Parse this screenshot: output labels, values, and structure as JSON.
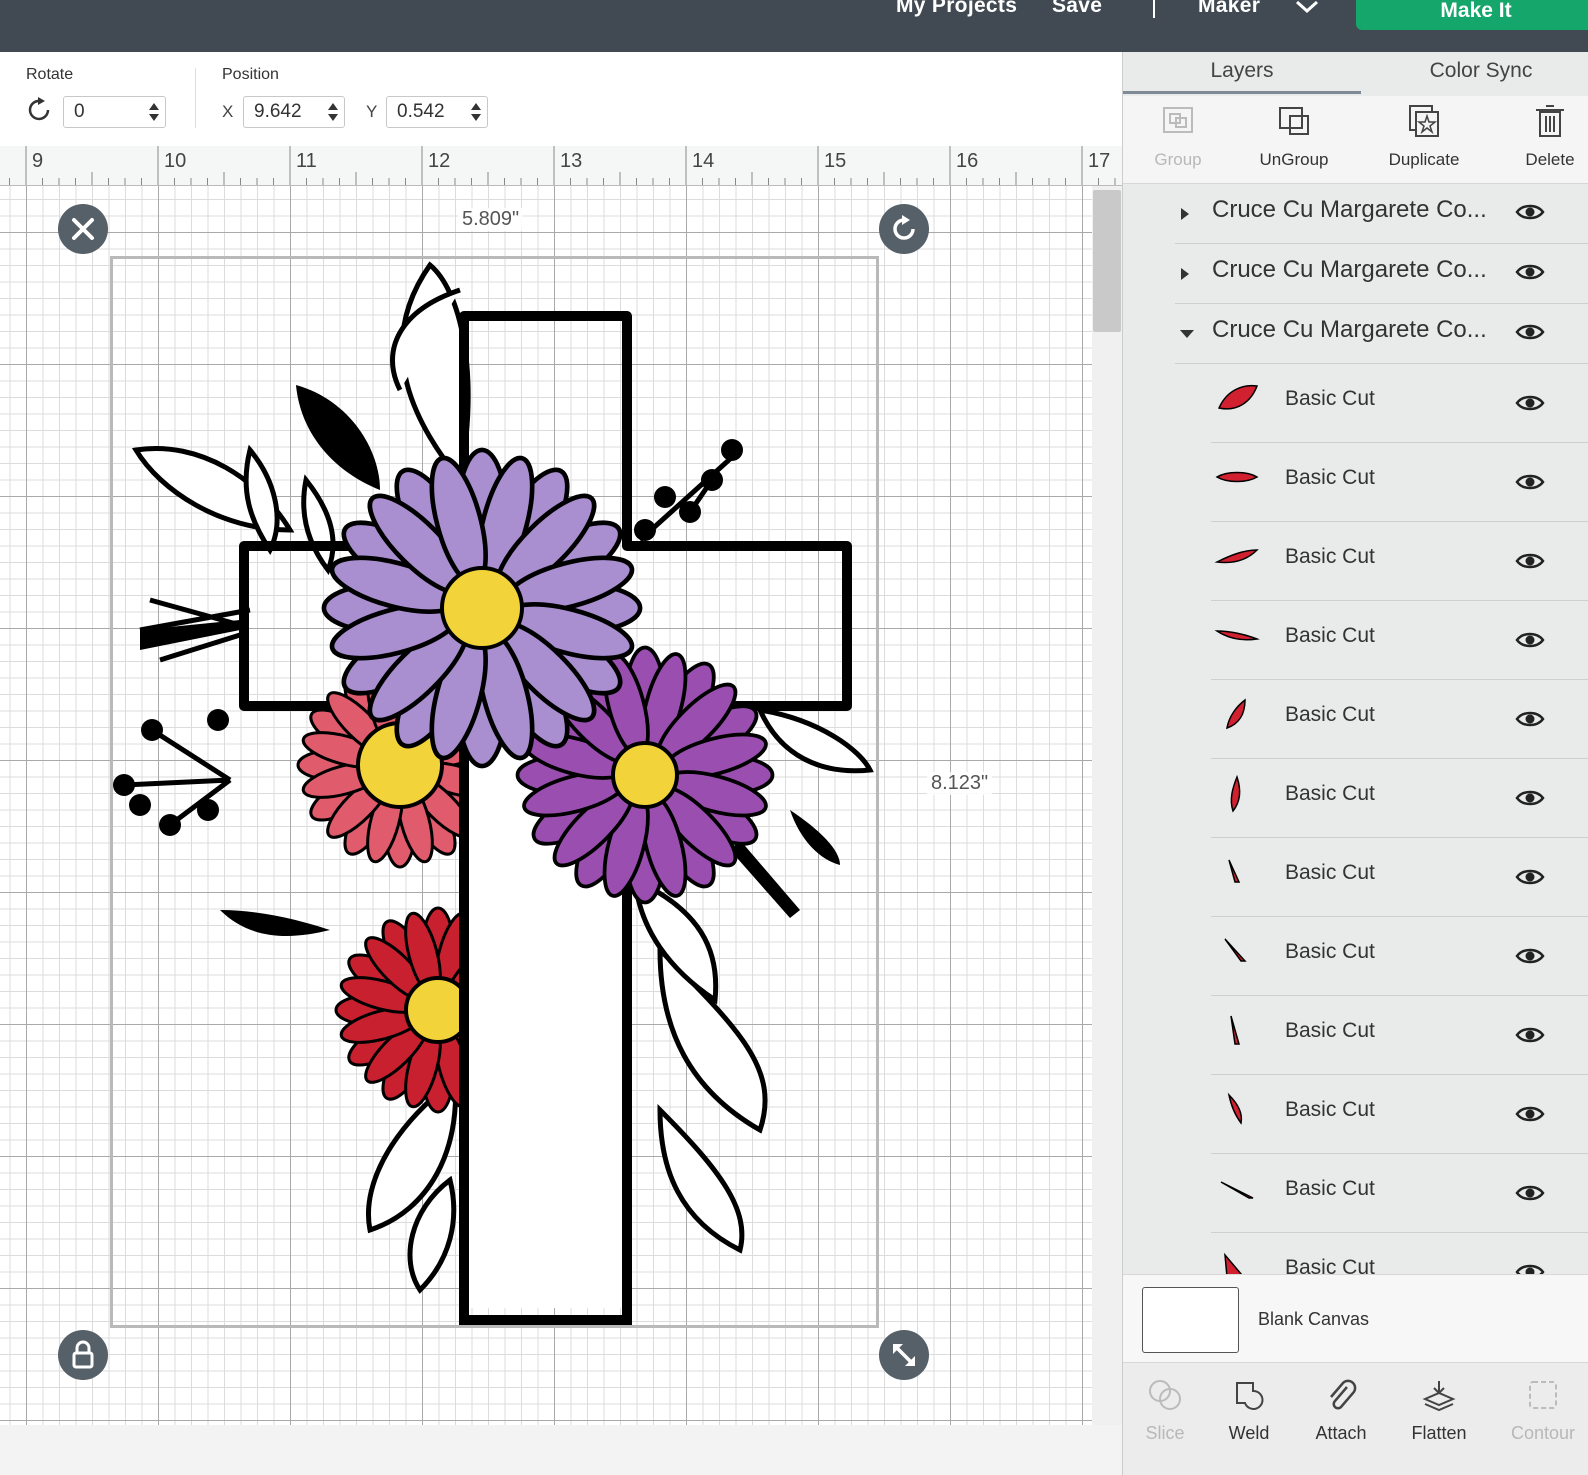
{
  "header": {
    "my_projects_label": "My Projects",
    "save_label": "Save",
    "machine_label": "Maker",
    "make_it_label": "Make It"
  },
  "toolbar": {
    "rotate_label": "Rotate",
    "rotate_value": "0",
    "position_label": "Position",
    "x_label": "X",
    "x_value": "9.642",
    "y_label": "Y",
    "y_value": "0.542"
  },
  "ruler": {
    "ticks": [
      "9",
      "10",
      "11",
      "12",
      "13",
      "14",
      "15",
      "16",
      "17"
    ]
  },
  "canvas": {
    "width_readout": "5.809\"",
    "height_readout": "8.123\""
  },
  "panel": {
    "tabs": [
      {
        "label": "Layers",
        "active": true
      },
      {
        "label": "Color Sync",
        "active": false
      }
    ],
    "tools": [
      {
        "label": "Group",
        "enabled": false
      },
      {
        "label": "UnGroup",
        "enabled": true
      },
      {
        "label": "Duplicate",
        "enabled": true
      },
      {
        "label": "Delete",
        "enabled": true
      }
    ],
    "groups": [
      {
        "name": "Cruce Cu Margarete Co...",
        "expanded": false
      },
      {
        "name": "Cruce Cu Margarete Co...",
        "expanded": false
      },
      {
        "name": "Cruce Cu Margarete Co...",
        "expanded": true
      }
    ],
    "layers": [
      {
        "name": "Basic Cut",
        "color": "#d1202f",
        "icon": "petal-thumbnail"
      },
      {
        "name": "Basic Cut",
        "color": "#d1202f",
        "icon": "petal-thumbnail"
      },
      {
        "name": "Basic Cut",
        "color": "#d1202f",
        "icon": "petal-thumbnail"
      },
      {
        "name": "Basic Cut",
        "color": "#d1202f",
        "icon": "petal-thumbnail"
      },
      {
        "name": "Basic Cut",
        "color": "#d1202f",
        "icon": "petal-thumbnail"
      },
      {
        "name": "Basic Cut",
        "color": "#d1202f",
        "icon": "petal-thumbnail"
      },
      {
        "name": "Basic Cut",
        "color": "#d1202f",
        "icon": "petal-thumbnail"
      },
      {
        "name": "Basic Cut",
        "color": "#d1202f",
        "icon": "petal-thumbnail"
      },
      {
        "name": "Basic Cut",
        "color": "#d1202f",
        "icon": "petal-thumbnail"
      },
      {
        "name": "Basic Cut",
        "color": "#d1202f",
        "icon": "petal-thumbnail"
      },
      {
        "name": "Basic Cut",
        "color": "#d1202f",
        "icon": "petal-thumbnail"
      },
      {
        "name": "Basic Cut",
        "color": "#d1202f",
        "icon": "petal-thumbnail"
      }
    ],
    "blank_canvas_label": "Blank Canvas",
    "bottom_tools": [
      {
        "label": "Slice",
        "enabled": false
      },
      {
        "label": "Weld",
        "enabled": true
      },
      {
        "label": "Attach",
        "enabled": true
      },
      {
        "label": "Flatten",
        "enabled": true
      },
      {
        "label": "Contour",
        "enabled": false
      }
    ]
  },
  "colors": {
    "topbar": "#414a52",
    "make_it": "#14a66b",
    "handle": "#566068",
    "lavender_flower": "#a98fd0",
    "purple_flower": "#9a4fb0",
    "pink_flower": "#e05b6b",
    "red_flower": "#c8202e",
    "flower_center": "#f2d43a"
  }
}
